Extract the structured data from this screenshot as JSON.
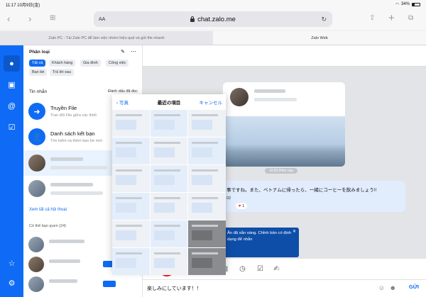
{
  "status": {
    "time": "11:17",
    "date": "10月9日(金)",
    "battery": "34%"
  },
  "browser": {
    "url_text": "chat.zalo.me",
    "aa_label": "AA",
    "tabs": [
      {
        "label": "Zalo PC - Tải Zalo PC để làm việc nhóm hiệu quả và gửi file nhanh"
      },
      {
        "label": "Zalo Web"
      }
    ]
  },
  "sidebar": {
    "category_title": "Phân loại",
    "chips": [
      "Tất cả",
      "Khách hàng",
      "Gia đình",
      "Công việc",
      "Bạn bè",
      "Trả lời sau"
    ],
    "messages_title": "Tin nhắn",
    "mark_read": "Đánh dấu đã đọc",
    "conversations": [
      {
        "name": "Truyền File",
        "sub": "Trao đổi File giữa các thiết"
      },
      {
        "name": "Danh sách kết bạn",
        "sub": "Tìm kiếm và thêm bạn bè mới"
      }
    ],
    "see_all": "Xem tất cả hội thoại",
    "friends_title": "Có thể bạn quen (24)"
  },
  "picker": {
    "back_label": "写真",
    "title": "最近の項目",
    "cancel_label": "キャンセル"
  },
  "chat": {
    "time_pill": "10:52 Hôm nay",
    "message_text": "事ですね。また、ベトナムに帰ったら、一緒にコーヒーを飲みましょう!!",
    "message_sub": "02",
    "reaction": "1",
    "tooltip_text": "Ấn đã sẵn sàng. Chỉnh bản có định dạng để nhắn",
    "compose_text": "楽しみにしています！！",
    "send_label": "GỬI"
  },
  "colors": {
    "brand": "#0f6bf5",
    "highlight_circle": "#e11111"
  }
}
